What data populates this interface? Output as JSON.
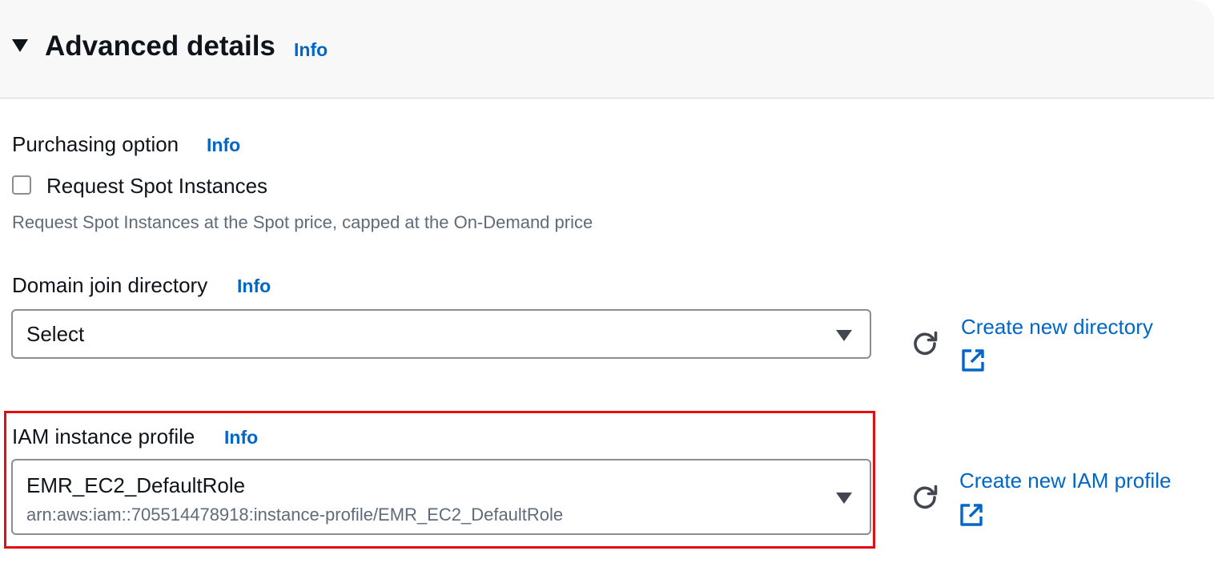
{
  "header": {
    "title": "Advanced details",
    "info": "Info",
    "caret_icon": "caret-down-icon"
  },
  "purchasing": {
    "label": "Purchasing option",
    "info": "Info",
    "checkbox_label": "Request Spot Instances",
    "checked": false,
    "description": "Request Spot Instances at the Spot price, capped at the On-Demand price"
  },
  "domain_join": {
    "label": "Domain join directory",
    "info": "Info",
    "selected": "Select",
    "refresh_icon": "refresh-icon",
    "create_link": "Create new directory",
    "external_icon": "external-link-icon"
  },
  "iam_profile": {
    "label": "IAM instance profile",
    "info": "Info",
    "selected": "EMR_EC2_DefaultRole",
    "selected_detail": "arn:aws:iam::705514478918:instance-profile/EMR_EC2_DefaultRole",
    "refresh_icon": "refresh-icon",
    "create_link": "Create new IAM profile",
    "external_icon": "external-link-icon"
  },
  "colors": {
    "link": "#0066c7",
    "text": "#0f141a",
    "secondary_text": "#5f6b7a",
    "highlight_border": "#e01010",
    "header_background": "#f8f8f8"
  }
}
